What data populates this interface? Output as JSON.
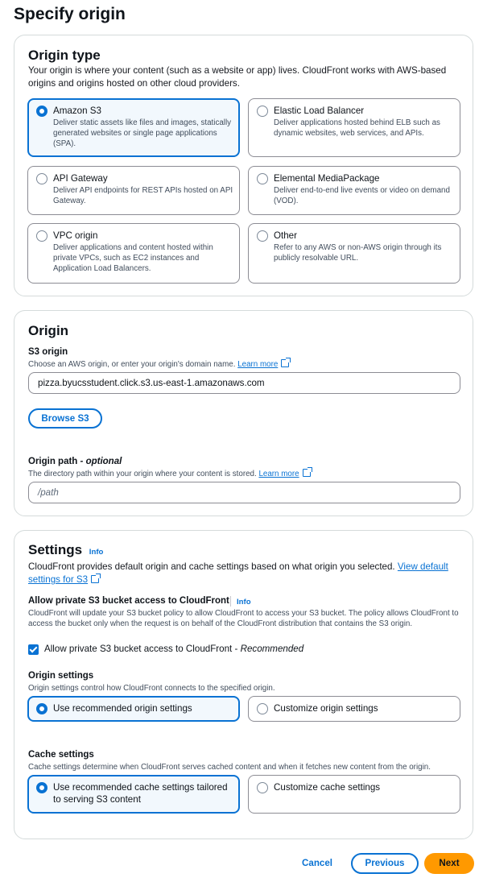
{
  "page": {
    "title": "Specify origin"
  },
  "origin_type": {
    "title": "Origin type",
    "description": "Your origin is where your content (such as a website or app) lives. CloudFront works with AWS-based origins and origins hosted on other cloud providers.",
    "options": [
      {
        "label": "Amazon S3",
        "description": "Deliver static assets like files and images, statically generated websites or single page applications (SPA).",
        "selected": true
      },
      {
        "label": "Elastic Load Balancer",
        "description": "Deliver applications hosted behind ELB such as dynamic websites, web services, and APIs.",
        "selected": false
      },
      {
        "label": "API Gateway",
        "description": "Deliver API endpoints for REST APIs hosted on API Gateway.",
        "selected": false
      },
      {
        "label": "Elemental MediaPackage",
        "description": "Deliver end-to-end live events or video on demand (VOD).",
        "selected": false
      },
      {
        "label": "VPC origin",
        "description": "Deliver applications and content hosted within private VPCs, such as EC2 instances and Application Load Balancers.",
        "selected": false
      },
      {
        "label": "Other",
        "description": "Refer to any AWS or non-AWS origin through its publicly resolvable URL.",
        "selected": false
      }
    ]
  },
  "origin": {
    "title": "Origin",
    "s3_label": "S3 origin",
    "s3_description": "Choose an AWS origin, or enter your origin's domain name.",
    "learn_more": "Learn more",
    "s3_value": "pizza.byucsstudent.click.s3.us-east-1.amazonaws.com",
    "browse_label": "Browse S3",
    "path_label": "Origin path",
    "path_optional": "- optional",
    "path_description": "The directory path within your origin where your content is stored.",
    "path_placeholder": "/path"
  },
  "settings": {
    "title": "Settings",
    "info": "Info",
    "description": "CloudFront provides default origin and cache settings based on what origin you selected.",
    "view_link": "View default settings for S3",
    "access_label": "Allow private S3 bucket access to CloudFront",
    "access_info": "Info",
    "access_description": "CloudFront will update your S3 bucket policy to allow CloudFront to access your S3 bucket. The policy allows CloudFront to access the bucket only when the request is on behalf of the CloudFront distribution that contains the S3 origin.",
    "access_checkbox_label": "Allow private S3 bucket access to CloudFront - ",
    "access_checkbox_em": "Recommended",
    "access_checked": true,
    "origin_settings_label": "Origin settings",
    "origin_settings_description": "Origin settings control how CloudFront connects to the specified origin.",
    "origin_options": [
      {
        "label": "Use recommended origin settings",
        "selected": true
      },
      {
        "label": "Customize origin settings",
        "selected": false
      }
    ],
    "cache_settings_label": "Cache settings",
    "cache_settings_description": "Cache settings determine when CloudFront serves cached content and when it fetches new content from the origin.",
    "cache_options": [
      {
        "label": "Use recommended cache settings tailored to serving S3 content",
        "selected": true
      },
      {
        "label": "Customize cache settings",
        "selected": false
      }
    ]
  },
  "footer": {
    "cancel": "Cancel",
    "previous": "Previous",
    "next": "Next"
  },
  "colors": {
    "accent": "#0972d3",
    "primary_button": "#ff9900",
    "selected_tile_bg": "#f2f8fd"
  }
}
